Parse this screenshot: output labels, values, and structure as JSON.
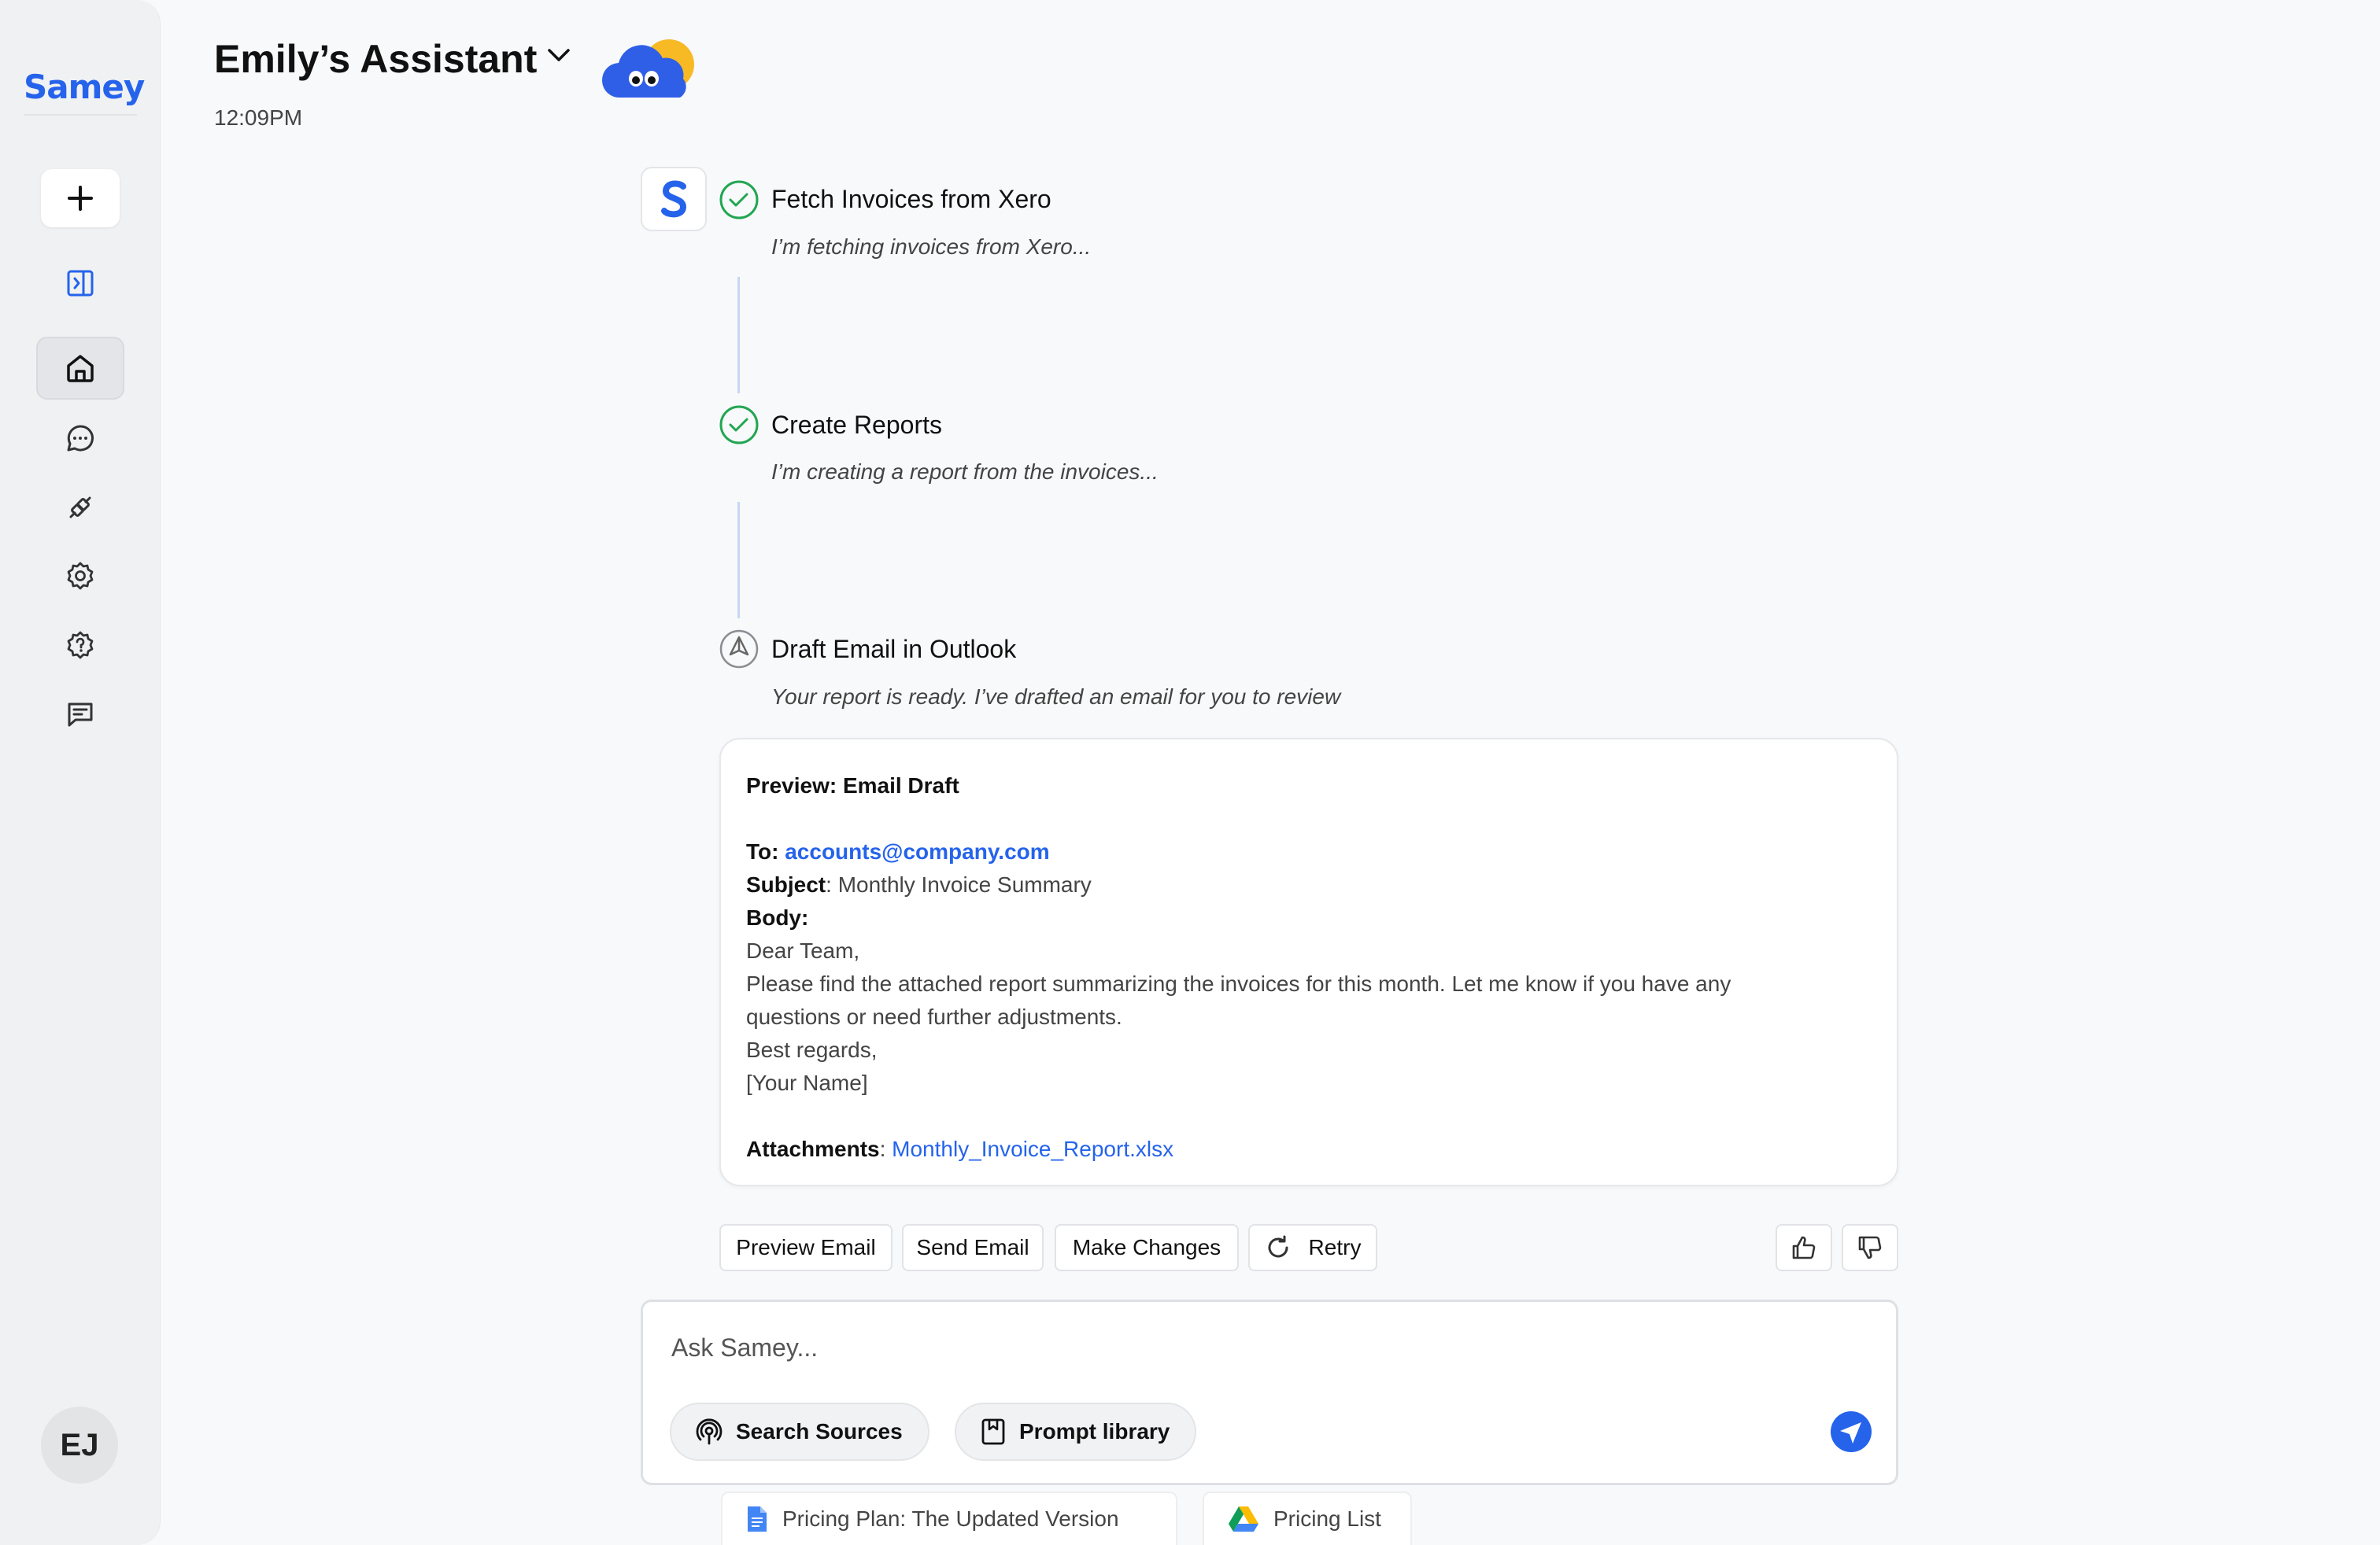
{
  "sidebar": {
    "logo": "Samey",
    "avatar_initials": "EJ",
    "items": [
      {
        "icon": "panel-toggle-icon"
      },
      {
        "icon": "home-icon",
        "active": true
      },
      {
        "icon": "chat-icon"
      },
      {
        "icon": "integrations-icon"
      },
      {
        "icon": "settings-icon"
      },
      {
        "icon": "help-icon"
      },
      {
        "icon": "feedback-icon"
      }
    ]
  },
  "header": {
    "title": "Emily’s Assistant",
    "time": "12:09PM"
  },
  "steps": [
    {
      "title": "Fetch Invoices from Xero",
      "description": "I’m fetching invoices from Xero...",
      "status": "done"
    },
    {
      "title": "Create Reports",
      "description": "I’m creating a report from the invoices...",
      "status": "done"
    },
    {
      "title": "Draft Email in Outlook",
      "description": "Your report is ready. I’ve drafted an email for you to review",
      "status": "in-progress"
    }
  ],
  "email": {
    "heading": "Preview: Email Draft",
    "to_label": "To:",
    "to": "accounts@company.com",
    "subject_label": "Subject",
    "subject": ": Monthly Invoice Summary",
    "body_label": "Body:",
    "body_lines": [
      "Dear Team,",
      "Please find the attached report summarizing the invoices for this month. Let me know if you have any",
      "questions or need further adjustments.",
      "Best regards,",
      "[Your Name]"
    ],
    "attachments_label": "Attachments",
    "attachments_sep": ": ",
    "attachment": "Monthly_Invoice_Report.xlsx"
  },
  "actions": {
    "preview": "Preview Email",
    "send": "Send Email",
    "changes": "Make Changes",
    "retry": "Retry"
  },
  "composer": {
    "placeholder": "Ask Samey...",
    "search_sources": "Search Sources",
    "prompt_library": "Prompt library"
  },
  "files": [
    {
      "name": "Pricing Plan: The Updated Version",
      "icon": "google-docs-icon"
    },
    {
      "name": "Pricing List",
      "icon": "google-drive-icon"
    }
  ],
  "colors": {
    "accent": "#2563eb",
    "success": "#22a652"
  }
}
